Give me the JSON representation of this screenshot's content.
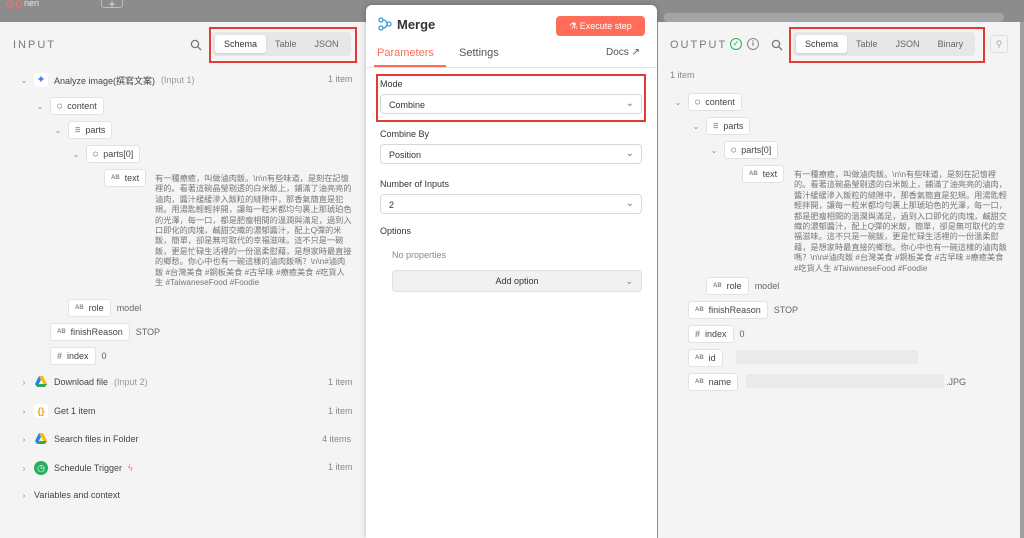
{
  "topbar": {
    "name": "nen",
    "plus": "+"
  },
  "input": {
    "title": "INPUT",
    "tabs": [
      "Schema",
      "Table",
      "JSON"
    ],
    "node1": {
      "label": "Analyze image(撰寫文案)",
      "sub": "(Input 1)",
      "count": "1 item"
    },
    "content": "content",
    "parts": "parts",
    "parts0": "parts[0]",
    "text_key": "text",
    "text_value": "有一種療癒，叫做滷肉飯。\\n\\n有些味道，是刻在記憶裡的。看著這碗晶瑩剔透的白米飯上，鋪滿了油亮亮的滷肉，醬汁緩緩滲入飯粒的縫隙中，那香氣簡直是犯規。用湯匙輕輕拌開，讓每一粒米都均勻裹上那琥珀色的光澤，每一口，都是肥瘦相間的溫潤與滿足，過到入口即化的肉塊，鹹甜交織的濃郁醬汁，配上Q彈的米飯，簡單，卻是無可取代的幸福滋味。這不只是一碗飯，更是忙碌生活裡的一份溫柔慰藉，是想家時最直接的鄉愁。你心中也有一碗這樣的滷肉飯嗎？\\n\\n#滷肉飯 #台灣美食 #銅板美食 #古早味 #療癒美食 #吃貨人生 #TaiwaneseFood #Foodie",
    "role_key": "role",
    "role_val": "model",
    "finish_key": "finishReason",
    "finish_val": "STOP",
    "index_key": "index",
    "index_val": "0",
    "nodes": [
      {
        "label": "Download file",
        "sub": "(Input 2)",
        "count": "1 item"
      },
      {
        "label": "Get 1 item",
        "sub": "",
        "count": "1 item"
      },
      {
        "label": "Search files in Folder",
        "sub": "",
        "count": "4 items"
      },
      {
        "label": "Schedule Trigger",
        "sub": "",
        "count": "1 item"
      }
    ],
    "vars": "Variables and context"
  },
  "middle": {
    "title": "Merge",
    "execute": "Execute step",
    "tabs": [
      "Parameters",
      "Settings"
    ],
    "docs": "Docs",
    "mode_label": "Mode",
    "mode_value": "Combine",
    "combine_label": "Combine By",
    "combine_value": "Position",
    "num_label": "Number of Inputs",
    "num_value": "2",
    "options_label": "Options",
    "no_props": "No properties",
    "add_option": "Add option"
  },
  "output": {
    "title": "OUTPUT",
    "tabs": [
      "Schema",
      "Table",
      "JSON",
      "Binary"
    ],
    "count": "1 item",
    "content": "content",
    "parts": "parts",
    "parts0": "parts[0]",
    "text_key": "text",
    "text_value": "有一種療癒，叫做滷肉飯。\\n\\n有些味道，是刻在記憶裡的。看著這碗晶瑩剔透的白米飯上，鋪滿了油亮亮的滷肉，醬汁緩緩滲入飯粒的縫隙中，那香氣簡直是犯規。用湯匙輕輕拌開，讓每一粒米都均勻裹上那琥珀色的光澤，每一口，都是肥瘦相間的溫潤與滿足，過到入口即化的肉塊，鹹甜交織的濃郁醬汁，配上Q彈的米飯，簡單，卻是無可取代的幸福滋味。這不只是一碗飯，更是忙碌生活裡的一份溫柔慰藉，是想家時最直接的鄉愁。你心中也有一碗這樣的滷肉飯嗎？\\n\\n#滷肉飯 #台灣美食 #銅板美食 #古早味 #療癒美食 #吃貨人生 #TaiwaneseFood #Foodie",
    "role_key": "role",
    "role_val": "model",
    "finish_key": "finishReason",
    "finish_val": "STOP",
    "index_key": "index",
    "index_val": "0",
    "id_key": "id",
    "name_key": "name",
    "name_val": ".JPG"
  },
  "colors": {
    "accent": "#ff6d5a",
    "red_outline": "#e53935",
    "success": "#27ae60"
  }
}
